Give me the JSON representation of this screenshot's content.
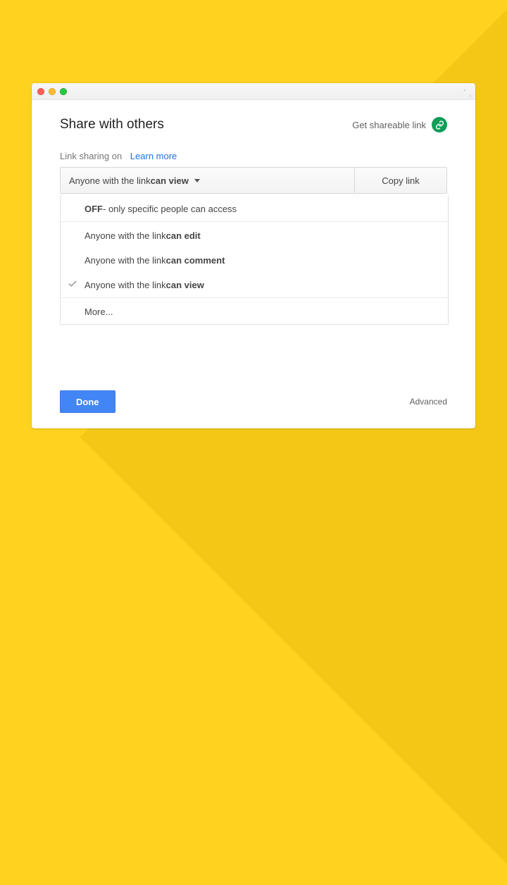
{
  "header": {
    "title": "Share with others",
    "get_link_label": "Get shareable link"
  },
  "sub": {
    "status": "Link sharing on",
    "learn_more": "Learn more"
  },
  "bar": {
    "prefix": "Anyone with the link ",
    "strong": "can view",
    "copy_label": "Copy link"
  },
  "dropdown": {
    "off_strong": "OFF",
    "off_rest": " - only specific people can access",
    "opt1_prefix": "Anyone with the link ",
    "opt1_strong": "can edit",
    "opt2_prefix": "Anyone with the link ",
    "opt2_strong": "can comment",
    "opt3_prefix": "Anyone with the link ",
    "opt3_strong": "can view",
    "more": "More..."
  },
  "footer": {
    "done": "Done",
    "advanced": "Advanced"
  }
}
